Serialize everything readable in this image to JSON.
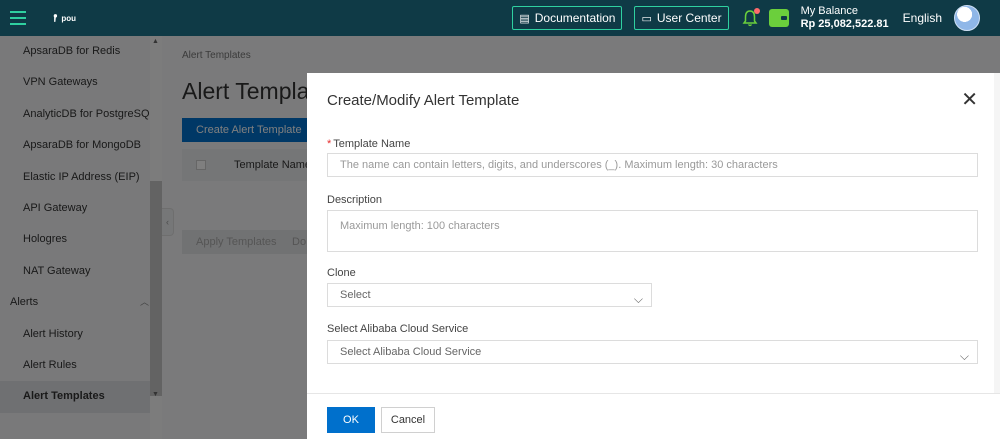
{
  "header": {
    "logo_text": "pou",
    "documentation_label": "Documentation",
    "user_center_label": "User Center",
    "balance_label": "My Balance",
    "balance_value": "Rp 25,082,522.81",
    "language": "English"
  },
  "sidebar": {
    "items": [
      {
        "label": "ApsaraDB for Redis"
      },
      {
        "label": "VPN Gateways"
      },
      {
        "label": "AnalyticDB for PostgreSQL"
      },
      {
        "label": "ApsaraDB for MongoDB"
      },
      {
        "label": "Elastic IP Address (EIP)"
      },
      {
        "label": "API Gateway"
      },
      {
        "label": "Hologres"
      },
      {
        "label": "NAT Gateway"
      },
      {
        "label": "Alerts"
      },
      {
        "label": "Alert History"
      },
      {
        "label": "Alert Rules"
      },
      {
        "label": "Alert Templates"
      }
    ]
  },
  "page": {
    "breadcrumb": "Alert Templates",
    "title": "Alert Templat",
    "create_button": "Create Alert Template",
    "column_name": "Template Name/I",
    "apply_button": "Apply Templates",
    "second_button": "Do"
  },
  "dialog": {
    "title": "Create/Modify Alert Template",
    "template_name_label": "Template Name",
    "template_name_placeholder": "The name can contain letters, digits, and underscores (_). Maximum length: 30 characters",
    "description_label": "Description",
    "description_placeholder": "Maximum length: 100 characters",
    "clone_label": "Clone",
    "clone_value": "Select",
    "service_label": "Select Alibaba Cloud Service",
    "service_value": "Select Alibaba Cloud Service",
    "ok_label": "OK",
    "cancel_label": "Cancel"
  }
}
